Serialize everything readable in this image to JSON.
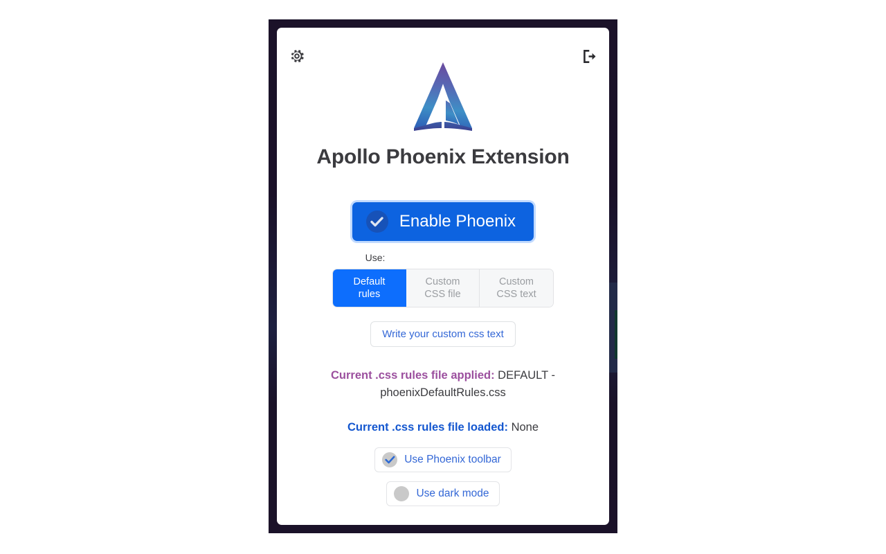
{
  "window": {
    "frame_color": "#1b1229",
    "card_background": "#ffffff"
  },
  "header": {
    "settings_icon": "gear-icon",
    "logout_icon": "logout-icon"
  },
  "brand": {
    "logo_icon": "apollo-phoenix-logo",
    "logo_gradient_from": "#6b4fa8",
    "logo_gradient_to": "#2f7fc4",
    "title": "Apollo Phoenix Extension"
  },
  "enable": {
    "label": "Enable Phoenix",
    "checked": true,
    "accent": "#0d63e0",
    "check_icon": "check-icon"
  },
  "use_section": {
    "label": "Use:",
    "selected_index": 0,
    "options": [
      {
        "label_line1": "Default",
        "label_line2": "rules"
      },
      {
        "label_line1": "Custom",
        "label_line2": "CSS file"
      },
      {
        "label_line1": "Custom",
        "label_line2": "CSS text"
      }
    ]
  },
  "custom_css": {
    "write_button_label": "Write your custom css text"
  },
  "status": {
    "applied": {
      "key": "Current .css rules file applied:",
      "value": "DEFAULT - phoenixDefaultRules.css",
      "key_color": "#9b4f9e"
    },
    "loaded": {
      "key": "Current .css rules file loaded:",
      "value": "None",
      "key_color": "#1356cf"
    }
  },
  "toggles": [
    {
      "label": "Use Phoenix toolbar",
      "checked": true,
      "icon": "check-icon"
    },
    {
      "label": "Use dark mode",
      "checked": false,
      "icon": "circle-icon"
    }
  ]
}
